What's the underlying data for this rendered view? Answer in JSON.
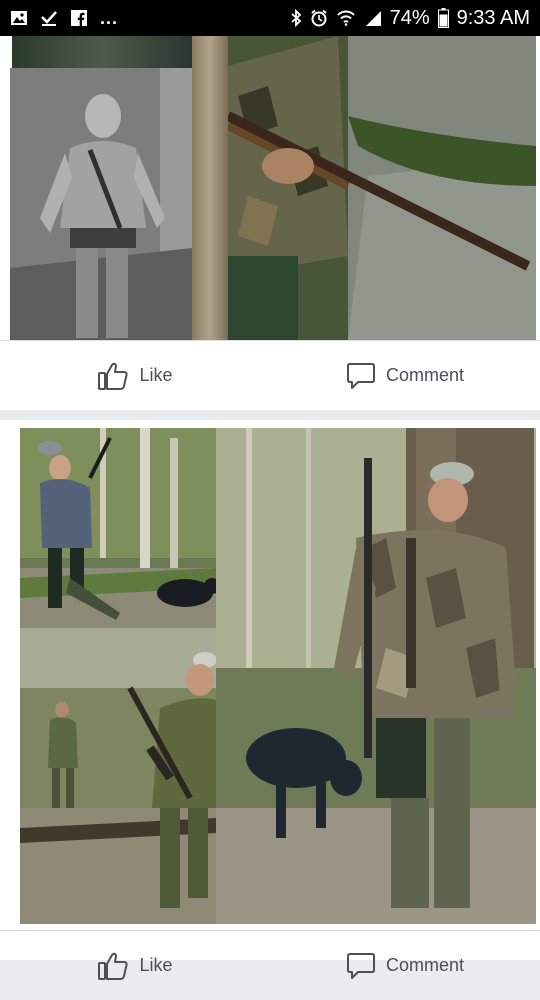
{
  "status_bar": {
    "left_icons": [
      "image-icon",
      "download-check-icon",
      "facebook-icon"
    ],
    "overflow": "...",
    "battery": "74%",
    "time": "9:33 AM",
    "right_icons": [
      "bluetooth-icon",
      "alarm-icon",
      "wifi-icon",
      "signal-icon",
      "battery-icon"
    ]
  },
  "posts": [
    {
      "photos": [
        {
          "scene": "grayscale photo of young man walking in forest"
        },
        {
          "scene": "close-up of camouflage jacket, hand holding rifle in forest"
        }
      ],
      "actions": {
        "like": "Like",
        "comment": "Comment"
      }
    },
    {
      "photos": [
        {
          "scene": "man in camouflage with rifle and dog in forest"
        },
        {
          "scene": "two hunters in camouflage walking in forest"
        },
        {
          "scene": "man in camouflage cap with rifle and dog in forest"
        }
      ],
      "actions": {
        "like": "Like",
        "comment": "Comment"
      }
    }
  ],
  "colors": {
    "background": "#e9ebee",
    "action_text": "#4b4f56",
    "status_bar": "#000000"
  }
}
